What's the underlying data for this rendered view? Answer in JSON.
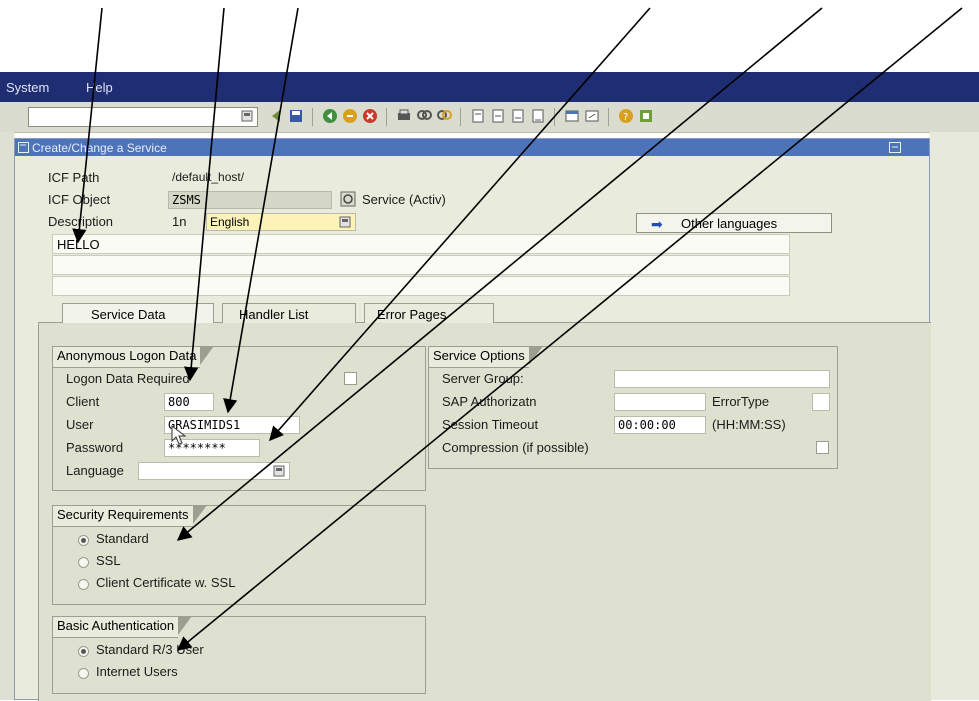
{
  "menu": {
    "items": [
      "System",
      "Help"
    ]
  },
  "dialog": {
    "title": "Create/Change a Service",
    "icf_path_label": "ICF Path",
    "icf_path_value": "/default_host/",
    "icf_object_label": "ICF Object",
    "icf_object_value": "ZSMS",
    "service_status": "Service (Activ)",
    "description_label": "Description",
    "language_code": "1n",
    "language_value": "English",
    "other_languages_label": "Other languages",
    "description_lines": [
      "HELLO",
      "",
      ""
    ]
  },
  "tabs": [
    {
      "label": "Service Data",
      "active": true
    },
    {
      "label": "Handler List",
      "active": false
    },
    {
      "label": "Error Pages",
      "active": false
    }
  ],
  "anonymous_logon": {
    "title": "Anonymous Logon Data",
    "logon_required_label": "Logon Data Required",
    "client_label": "Client",
    "client_value": "800",
    "user_label": "User",
    "user_value": "GRASIMIDS1",
    "password_label": "Password",
    "password_value": "********",
    "language_label": "Language",
    "language_value": ""
  },
  "service_options": {
    "title": "Service Options",
    "server_group_label": "Server Group:",
    "server_group_value": "",
    "sap_auth_label": "SAP Authorizatn",
    "sap_auth_value": "",
    "error_type_label": "ErrorType",
    "error_type_value": "",
    "session_timeout_label": "Session Timeout",
    "session_timeout_value": "00:00:00",
    "session_timeout_unit": "(HH:MM:SS)",
    "compression_label": "Compression (if possible)"
  },
  "security": {
    "title": "Security Requirements",
    "options": [
      "Standard",
      "SSL",
      "Client Certificate w. SSL"
    ],
    "selected": "Standard"
  },
  "basic_auth": {
    "title": "Basic Authentication",
    "options": [
      "Standard R/3 User",
      "Internet Users"
    ],
    "selected": "Standard R/3 User"
  },
  "colors": {
    "menubar": "#1f2d72",
    "dialog_title": "#4d73b8",
    "panel": "#e9ebdc",
    "arrow": "#000000"
  },
  "icons": [
    "save-icon",
    "back-icon",
    "exit-icon",
    "cancel-icon",
    "print-icon",
    "find-icon",
    "find-next-icon",
    "first-page-icon",
    "previous-page-icon",
    "next-page-icon",
    "last-page-icon",
    "new-session-icon",
    "shortcut-icon",
    "help-icon",
    "customize-icon"
  ]
}
